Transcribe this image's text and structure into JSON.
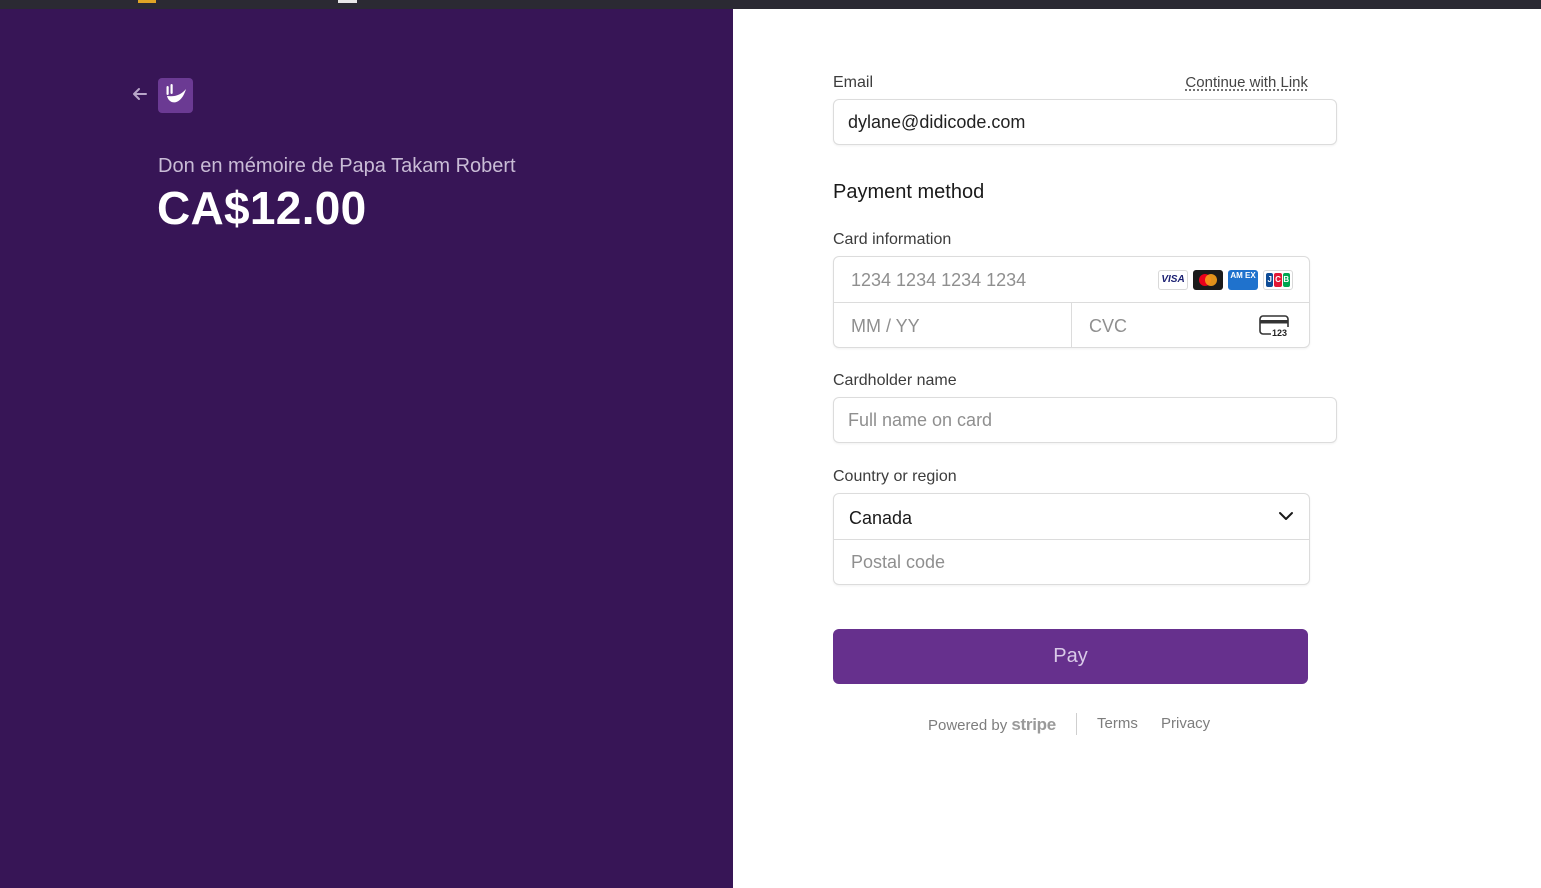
{
  "product": {
    "name": "Don en mémoire de Papa Takam Robert",
    "price": "CA$12.00"
  },
  "email": {
    "label": "Email",
    "link": "Continue with Link",
    "value": "dylane@didicode.com"
  },
  "payment_method": {
    "heading": "Payment method"
  },
  "card": {
    "label": "Card information",
    "number_placeholder": "1234 1234 1234 1234",
    "expiry_placeholder": "MM / YY",
    "cvc_placeholder": "CVC",
    "brands": [
      "visa-icon",
      "mastercard-icon",
      "amex-icon",
      "jcb-icon"
    ],
    "visa_text": "VISA",
    "amex_text": "AM EX",
    "cvc_icon_text": "123"
  },
  "cardholder": {
    "label": "Cardholder name",
    "placeholder": "Full name on card"
  },
  "country": {
    "label": "Country or region",
    "selected": "Canada",
    "postal_placeholder": "Postal code"
  },
  "pay_button": "Pay",
  "footer": {
    "powered_by": "Powered by",
    "brand": "stripe",
    "terms": "Terms",
    "privacy": "Privacy"
  },
  "colors": {
    "left_panel": "#371556",
    "pay_button": "#66308d",
    "logo": "#6b3a93"
  }
}
